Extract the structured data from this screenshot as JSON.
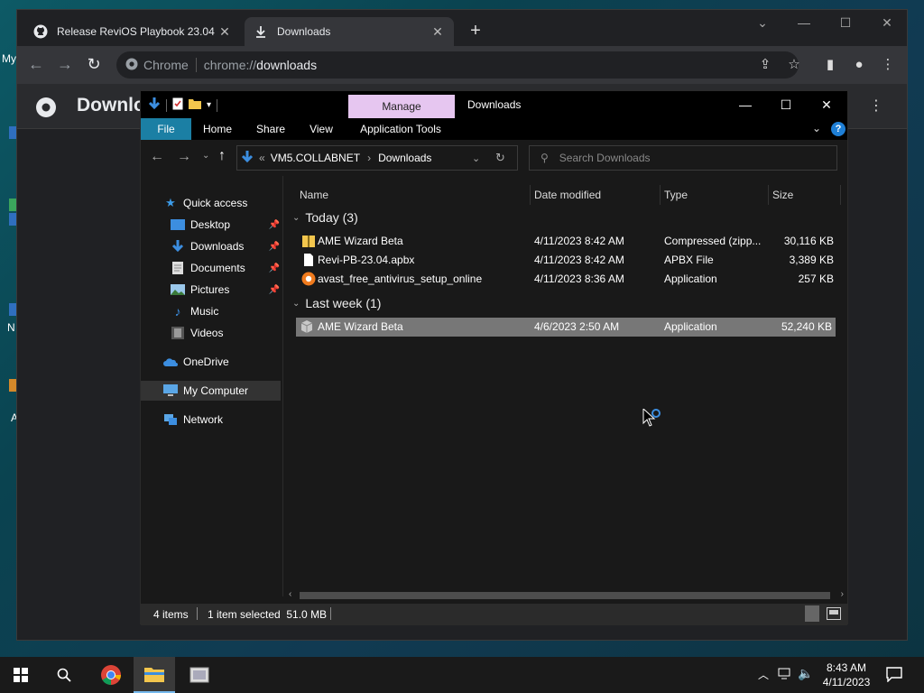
{
  "desktop": {
    "labels": [
      "My",
      "N",
      "A"
    ]
  },
  "chrome": {
    "tabs": [
      {
        "title": "Release ReviOS Playbook 23.04 ·",
        "icon": "github-icon"
      },
      {
        "title": "Downloads",
        "icon": "download-icon"
      }
    ],
    "omnibox": {
      "chip": "Chrome",
      "scheme": "chrome://",
      "host": "downloads"
    },
    "page_title": "Downlo"
  },
  "explorer": {
    "manage_tab": "Manage",
    "window_title": "Downloads",
    "ribbon_tabs": [
      "File",
      "Home",
      "Share",
      "View",
      "Application Tools"
    ],
    "breadcrumb": {
      "prefix": "«",
      "parts": [
        "VM5.COLLABNET",
        "Downloads"
      ]
    },
    "search_placeholder": "Search Downloads",
    "nav": {
      "quick_access": "Quick access",
      "pinned": [
        "Desktop",
        "Downloads",
        "Documents",
        "Pictures"
      ],
      "unpinned": [
        "Music",
        "Videos"
      ],
      "onedrive": "OneDrive",
      "my_computer": "My Computer",
      "network": "Network"
    },
    "columns": [
      "Name",
      "Date modified",
      "Type",
      "Size"
    ],
    "groups": [
      {
        "label": "Today (3)",
        "files": [
          {
            "name": "AME Wizard Beta",
            "date": "4/11/2023 8:42 AM",
            "type": "Compressed (zipp...",
            "size": "30,116 KB",
            "icon": "zip-folder-icon"
          },
          {
            "name": "Revi-PB-23.04.apbx",
            "date": "4/11/2023 8:42 AM",
            "type": "APBX File",
            "size": "3,389 KB",
            "icon": "file-icon"
          },
          {
            "name": "avast_free_antivirus_setup_online",
            "date": "4/11/2023 8:36 AM",
            "type": "Application",
            "size": "257 KB",
            "icon": "avast-icon"
          }
        ]
      },
      {
        "label": "Last week (1)",
        "files": [
          {
            "name": "AME Wizard Beta",
            "date": "4/6/2023 2:50 AM",
            "type": "Application",
            "size": "52,240 KB",
            "icon": "app-icon"
          }
        ]
      }
    ],
    "status": {
      "items": "4 items",
      "selected": "1 item selected  51.0 MB"
    }
  },
  "taskbar": {
    "time": "8:43 AM",
    "date": "4/11/2023"
  },
  "colors": {
    "manage_tab": "#e6c6f0",
    "file_tab": "#1b7fa4",
    "selection": "#777777"
  }
}
